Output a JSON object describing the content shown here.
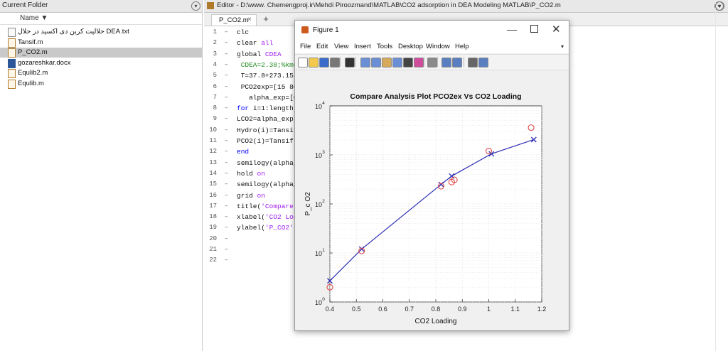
{
  "folder": {
    "title": "Current Folder",
    "menu_icon": "menu-circle-icon",
    "column_name": "Name ▼",
    "files": [
      {
        "name": "حلالیت کربن دی اکسید در حلال DEA.txt",
        "type": "txt",
        "selected": false
      },
      {
        "name": "Tansif.m",
        "type": "m",
        "selected": false
      },
      {
        "name": "P_CO2.m",
        "type": "m",
        "selected": true
      },
      {
        "name": "gozareshkar.docx",
        "type": "docx",
        "selected": false
      },
      {
        "name": "Equlib2.m",
        "type": "m",
        "selected": false
      },
      {
        "name": "Equlib.m",
        "type": "m",
        "selected": false
      }
    ]
  },
  "editor": {
    "title": "Editor - D:\\www. Chemengproj.ir\\Mehdi Piroozmand\\MATLAB\\CO2 adsorption in DEA Modeling MATLAB\\P_CO2.m",
    "tab_label": "P_CO2.m",
    "tab_close": "×",
    "tab_add": "+",
    "line_numbers": [
      "1",
      "2",
      "3",
      "4",
      "5",
      "6",
      "7",
      "8",
      "9",
      "10",
      "11",
      "12",
      "13",
      "14",
      "15",
      "16",
      "17",
      "18",
      "19",
      "20",
      "21",
      "22"
    ],
    "code_lines": [
      [
        {
          "t": "clc",
          "c": ""
        }
      ],
      [
        {
          "t": "clear ",
          "c": ""
        },
        {
          "t": "all",
          "c": "str"
        }
      ],
      [
        {
          "t": "global ",
          "c": ""
        },
        {
          "t": "CDEA",
          "c": "str"
        }
      ],
      [
        {
          "t": " CDEA=2.38;%kmo",
          "c": "cmt"
        }
      ],
      [
        {
          "t": " T=37.8+273.15;",
          "c": ""
        }
      ],
      [
        {
          "t": " PCO2exp=[15 80",
          "c": ""
        }
      ],
      [
        {
          "t": "   alpha_exp=[0.",
          "c": ""
        }
      ],
      [
        {
          "t": "for ",
          "c": "kw"
        },
        {
          "t": "i=1:length(",
          "c": ""
        }
      ],
      [
        {
          "t": "LCO2=alpha_exp(",
          "c": ""
        }
      ],
      [
        {
          "t": "Hydro(i)=Tansif",
          "c": ""
        }
      ],
      [
        {
          "t": "PCO2(i)=Tansif(",
          "c": ""
        }
      ],
      [
        {
          "t": "end",
          "c": "kw"
        }
      ],
      [
        {
          "t": "semilogy(alpha_",
          "c": ""
        }
      ],
      [
        {
          "t": "hold ",
          "c": ""
        },
        {
          "t": "on",
          "c": "str"
        }
      ],
      [
        {
          "t": "semilogy(alpha_",
          "c": ""
        }
      ],
      [
        {
          "t": "grid ",
          "c": ""
        },
        {
          "t": "on",
          "c": "str"
        }
      ],
      [
        {
          "t": "title(",
          "c": ""
        },
        {
          "t": "'Compare ",
          "c": "str"
        }
      ],
      [
        {
          "t": "xlabel(",
          "c": ""
        },
        {
          "t": "'CO2 Loa",
          "c": "str"
        }
      ],
      [
        {
          "t": "ylabel(",
          "c": ""
        },
        {
          "t": "'P_CO2'",
          "c": "str"
        },
        {
          "t": ")",
          "c": ""
        }
      ],
      [],
      [],
      []
    ]
  },
  "figure": {
    "window_title": "Figure 1",
    "controls": {
      "minimize": "—",
      "close": "✕"
    },
    "menu": [
      "File",
      "Edit",
      "View",
      "Insert",
      "Tools",
      "Desktop",
      "Window",
      "Help"
    ],
    "menu_arrow": "▾",
    "toolbar_icons": [
      "new-figure-icon",
      "open-icon",
      "save-icon",
      "print-icon",
      "pointer-icon",
      "zoom-in-icon",
      "zoom-out-icon",
      "pan-icon",
      "rotate-icon",
      "data-cursor-icon",
      "brush-icon",
      "link-icon",
      "colorbar-icon",
      "legend-icon",
      "hide-tools-icon",
      "dock-icon"
    ]
  },
  "chart_data": {
    "type": "scatter",
    "title": "Compare Analysis Plot PCO2ex Vs CO2 Loading",
    "xlabel": "CO2 Loading",
    "ylabel": "P_c O2",
    "x_scale": "linear",
    "y_scale": "log",
    "xlim": [
      0.4,
      1.2
    ],
    "ylim": [
      1,
      10000
    ],
    "x_ticks": [
      "0.4",
      "0.5",
      "0.6",
      "0.7",
      "0.8",
      "0.9",
      "1",
      "1.1",
      "1.2"
    ],
    "y_ticks": [
      {
        "base": "10",
        "exp": "0",
        "value": 1
      },
      {
        "base": "10",
        "exp": "1",
        "value": 10
      },
      {
        "base": "10",
        "exp": "2",
        "value": 100
      },
      {
        "base": "10",
        "exp": "3",
        "value": 1000
      },
      {
        "base": "10",
        "exp": "4",
        "value": 10000
      }
    ],
    "grid": true,
    "series": [
      {
        "marker": "x",
        "color": "#2b2bb3",
        "line": true,
        "x": [
          0.4,
          0.52,
          0.82,
          0.86,
          1.01,
          1.17
        ],
        "y": [
          2.7,
          12,
          250,
          370,
          1050,
          2050
        ]
      },
      {
        "marker": "o",
        "color": "#e04a4a",
        "line": false,
        "x": [
          0.4,
          0.52,
          0.82,
          0.86,
          0.87,
          1.0,
          1.16
        ],
        "y": [
          2,
          11,
          230,
          280,
          310,
          1200,
          3600
        ]
      }
    ]
  },
  "colors": {
    "line_series": "#2b2bb3",
    "marker_series": "#e04a4a",
    "selected_row": "#c9c9c9",
    "keyword": "#0000ff",
    "string": "#a020f0",
    "comment": "#228b22"
  }
}
